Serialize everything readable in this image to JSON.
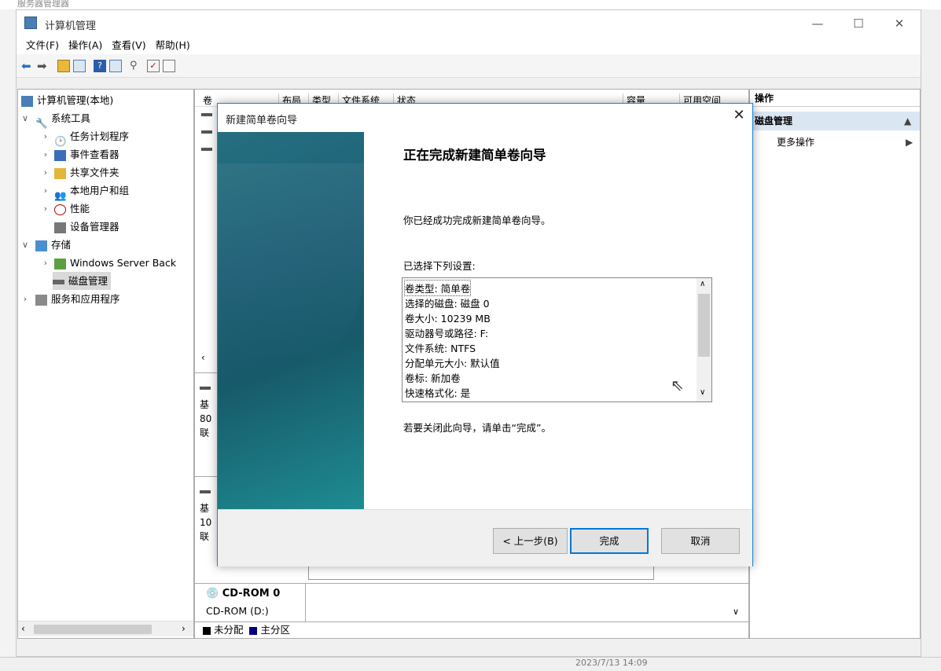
{
  "background": {
    "title": "服务器管理器",
    "taskbar_time": "2023/7/13 14:09"
  },
  "window": {
    "title": "计算机管理",
    "minimize": "—",
    "maximize": "☐",
    "close": "✕"
  },
  "menu": [
    "文件(F)",
    "操作(A)",
    "查看(V)",
    "帮助(H)"
  ],
  "tree": {
    "root": "计算机管理(本地)",
    "system_tools": "系统工具",
    "task_scheduler": "任务计划程序",
    "event_viewer": "事件查看器",
    "shared_folders": "共享文件夹",
    "local_users": "本地用户和组",
    "performance": "性能",
    "device_manager": "设备管理器",
    "storage": "存储",
    "windows_backup": "Windows Server Back",
    "disk_management": "磁盘管理",
    "services_apps": "服务和应用程序"
  },
  "volume_table": {
    "columns": [
      "卷",
      "布局",
      "类型",
      "文件系统",
      "状态",
      "容量",
      "可用空间"
    ]
  },
  "disk_panels": {
    "disk0": [
      "基",
      "80",
      "联"
    ],
    "disk1": [
      "基",
      "10",
      "联"
    ],
    "cdrom_title": "CD-ROM 0",
    "cdrom_sub": "CD-ROM (D:)"
  },
  "legend": {
    "unallocated": "未分配",
    "primary": "主分区"
  },
  "actions": {
    "header": "操作",
    "section": "磁盘管理",
    "more": "更多操作"
  },
  "dialog": {
    "title": "新建简单卷向导",
    "heading": "正在完成新建简单卷向导",
    "done_text": "你已经成功完成新建简单卷向导。",
    "settings_label": "已选择下列设置:",
    "settings": [
      "卷类型: 简单卷",
      "选择的磁盘: 磁盘 0",
      "卷大小: 10239 MB",
      "驱动器号或路径: F:",
      "文件系统: NTFS",
      "分配单元大小: 默认值",
      "卷标: 新加卷",
      "快速格式化: 是"
    ],
    "close_hint": "若要关闭此向导，请单击“完成”。",
    "back_button": "< 上一步(B)",
    "finish_button": "完成",
    "cancel_button": "取消"
  },
  "colors": {
    "accent": "#0078d7",
    "primary_partition": "#00007f",
    "unallocated": "#000000"
  }
}
